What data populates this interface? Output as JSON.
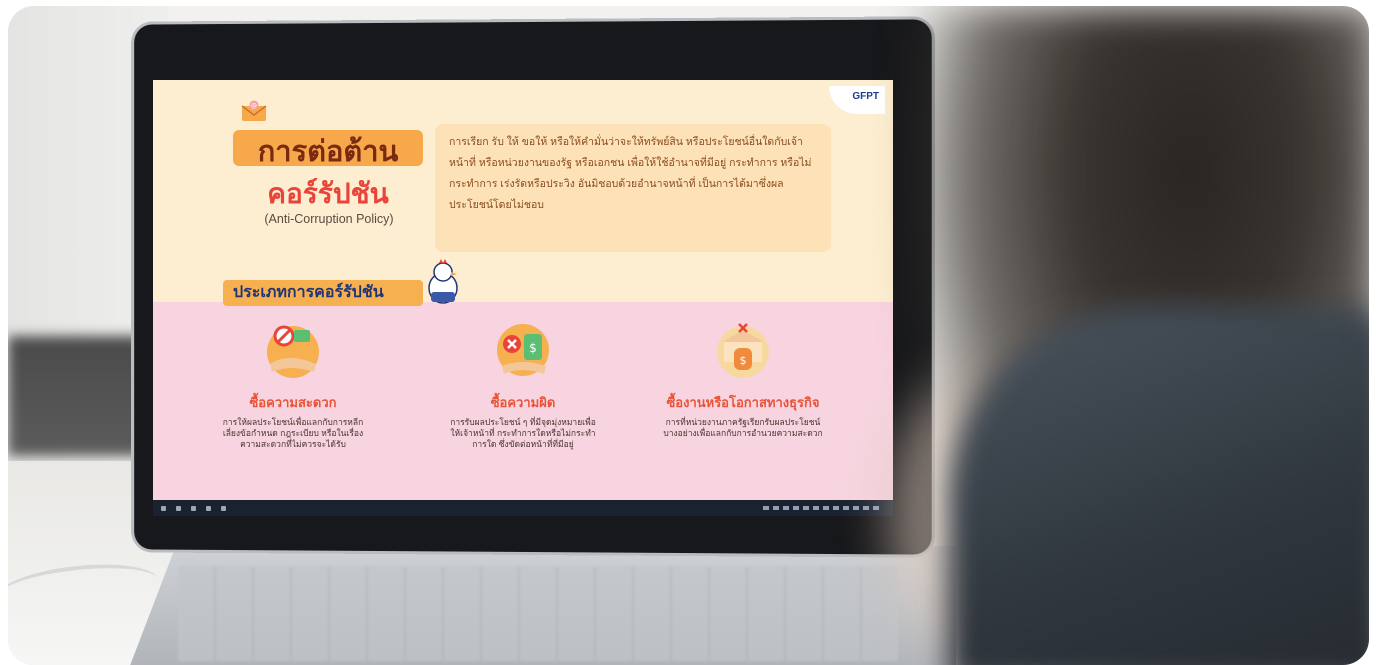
{
  "screen": {
    "logo_text": "GFPT",
    "title_line1": "การต่อต้าน",
    "title_line2": "คอร์รัปชัน",
    "title_en": "(Anti-Corruption Policy)",
    "description": "การเรียก รับ ให้ ขอให้ หรือให้คำมั่นว่าจะให้ทรัพย์สิน หรือประโยชน์อื่นใดกับเจ้าหน้าที่ หรือหน่วยงานของรัฐ หรือเอกชน เพื่อให้ใช้อำนาจที่มีอยู่ กระทำการ หรือไม่กระทำการ เร่งรัดหรือประวิง อันมิชอบด้วยอำนาจหน้าที่ เป็นการได้มาซึ่งผลประโยชน์โดยไม่ชอบ",
    "types_label": "ประเภทการคอร์รัปชัน",
    "cards": [
      {
        "title": "ซื้อความสะดวก",
        "text": "การให้ผลประโยชน์เพื่อแลกกับการหลีกเลี่ยงข้อกำหนด กฎระเบียบ หรือในเรื่องความสะดวกที่ไม่ควรจะได้รับ",
        "icon": "bribe-exchange-icon"
      },
      {
        "title": "ซื้อความผิด",
        "text": "การรับผลประโยชน์ ๆ ที่มีจุดมุ่งหมายเพื่อให้เจ้าหน้าที่ กระทำการใดหรือไม่กระทำการใด ซึ่งขัดต่อหน้าที่ที่มีอยู่",
        "icon": "money-bag-reject-icon"
      },
      {
        "title": "ซื้องานหรือโอกาสทางธุรกิจ",
        "text": "การที่หน่วยงานภาครัฐเรียกรับผลประโยชน์บางอย่างเพื่อแลกกับการอำนวยความสะดวก",
        "icon": "bank-money-icon"
      }
    ]
  },
  "colors": {
    "accent_orange": "#f7a84a",
    "title_red": "#e8443a",
    "pink_band": "#f7d4df",
    "cream": "#fdeed1",
    "navy": "#1f3578"
  }
}
